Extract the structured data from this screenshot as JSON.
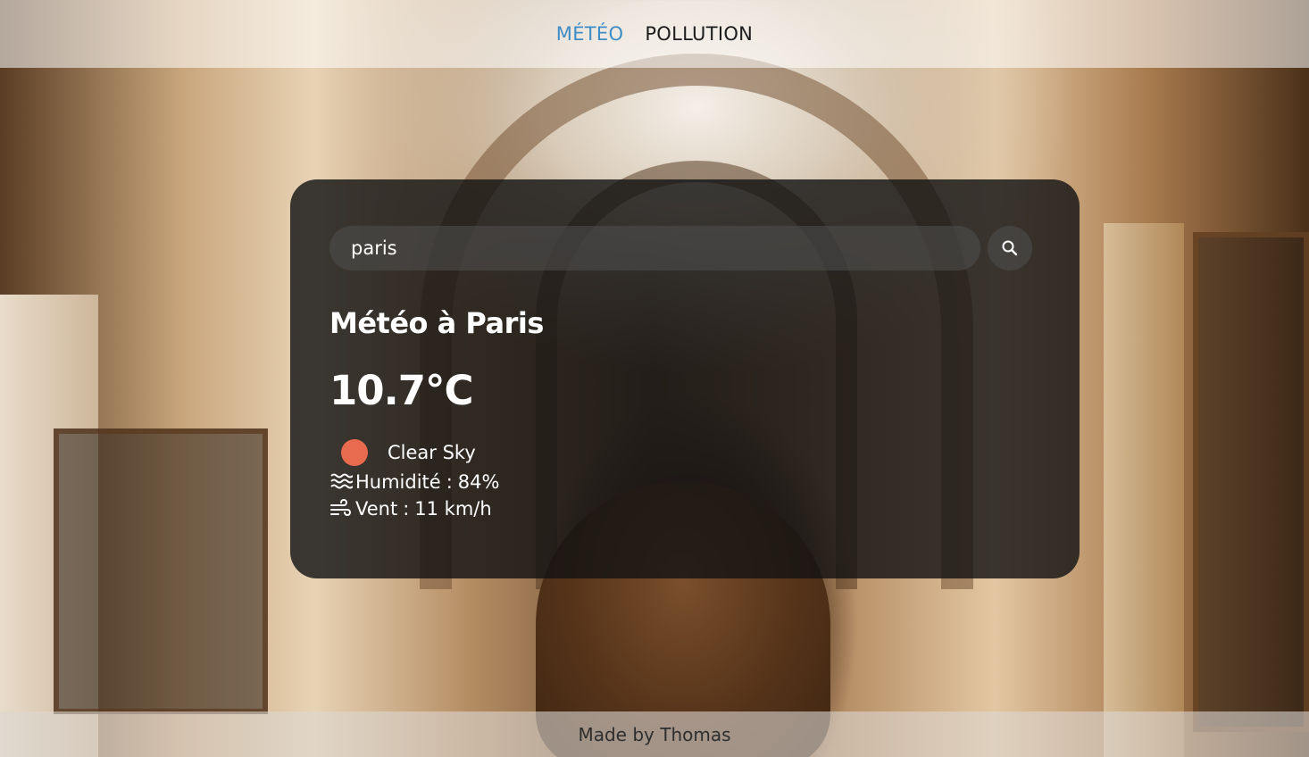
{
  "nav": {
    "items": [
      {
        "label": "MÉTÉO",
        "active": true
      },
      {
        "label": "POLLUTION",
        "active": false
      }
    ],
    "active_color": "#3f8dc6"
  },
  "search": {
    "value": "paris",
    "button_icon": "search-icon"
  },
  "weather": {
    "title": "Météo à Paris",
    "temperature": "10.7°C",
    "condition": "Clear Sky",
    "condition_icon": "sun-dot-icon",
    "condition_color": "#e86a4f",
    "humidity_label": "Humidité",
    "humidity_value": "84%",
    "humidity_icon": "humidity-waves-icon",
    "wind_label": "Vent",
    "wind_value": "11 km/h",
    "wind_icon": "wind-icon"
  },
  "footer": {
    "text": "Made by Thomas"
  }
}
